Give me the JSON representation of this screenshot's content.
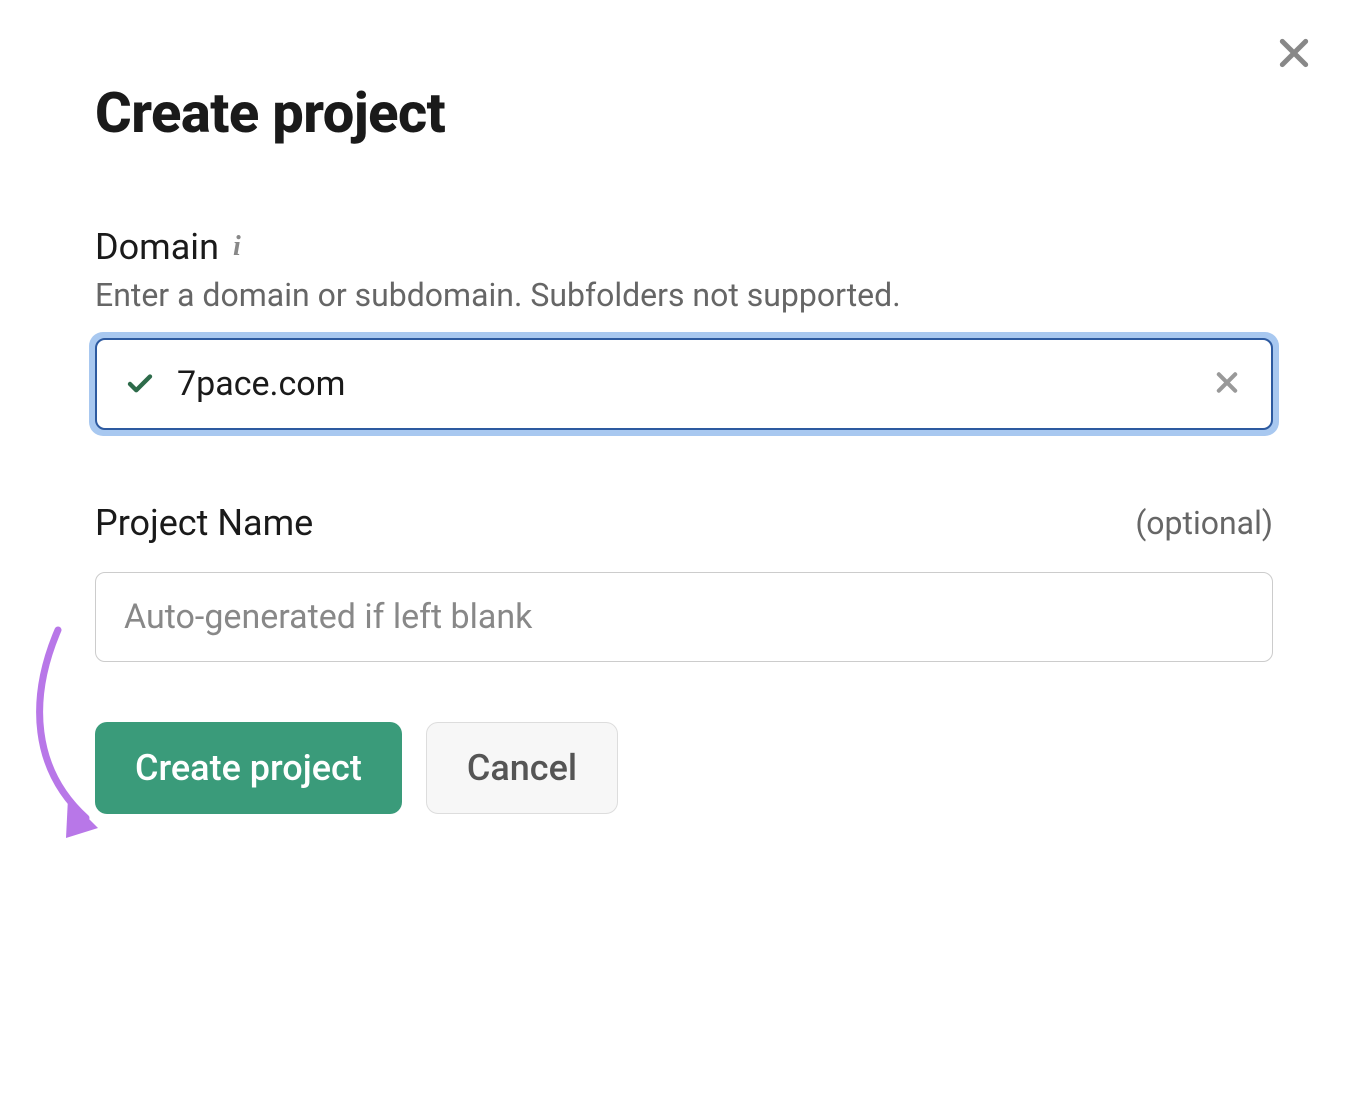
{
  "dialog": {
    "title": "Create project",
    "close_label": "Close"
  },
  "domain_field": {
    "label": "Domain",
    "hint": "Enter a domain or subdomain. Subfolders not supported.",
    "value": "7pace.com",
    "clear_label": "Clear"
  },
  "project_name_field": {
    "label": "Project Name",
    "optional": "(optional)",
    "placeholder": "Auto-generated if left blank",
    "value": ""
  },
  "buttons": {
    "create": "Create project",
    "cancel": "Cancel"
  },
  "colors": {
    "primary_button": "#3a9b7a",
    "focus_ring": "#a8c8f0",
    "focus_border": "#2d5aa0",
    "check_green": "#2d6b4a",
    "annotation": "#b877e8"
  }
}
